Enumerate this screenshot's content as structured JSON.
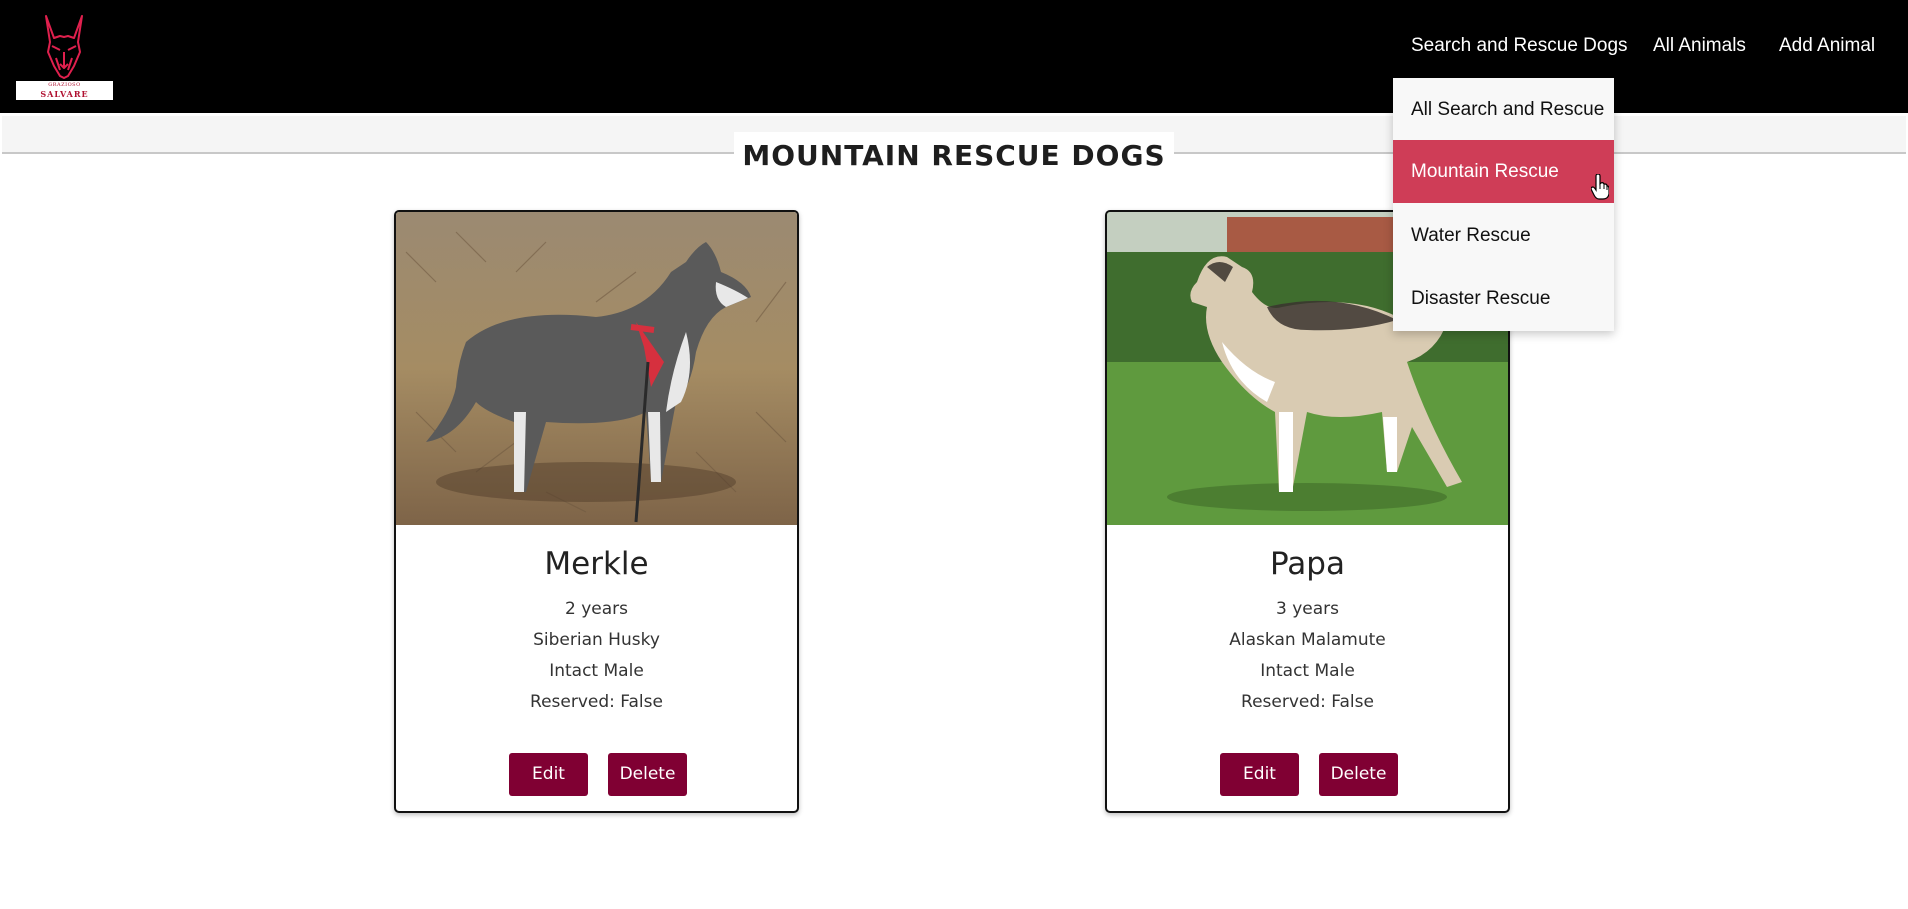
{
  "brand": {
    "logo_small_text": "GRAZIOSO",
    "logo_big_text": "SALVARE",
    "accent_color": "#800033",
    "highlight_color": "#cf3d57"
  },
  "nav": {
    "search_rescue_label": "Search and Rescue Dogs",
    "all_animals_label": "All Animals",
    "add_animal_label": "Add Animal"
  },
  "dropdown": {
    "items": [
      {
        "label": "All Search and Rescue"
      },
      {
        "label": "Mountain Rescue",
        "highlighted": true
      },
      {
        "label": "Water Rescue"
      },
      {
        "label": "Disaster Rescue"
      }
    ]
  },
  "page": {
    "title": "MOUNTAIN RESCUE DOGS"
  },
  "cards": [
    {
      "name": "Merkle",
      "age": "2 years",
      "breed": "Siberian Husky",
      "sex": "Intact Male",
      "reserved": "Reserved: False",
      "edit_label": "Edit",
      "delete_label": "Delete"
    },
    {
      "name": "Papa",
      "age": "3 years",
      "breed": "Alaskan Malamute",
      "sex": "Intact Male",
      "reserved": "Reserved: False",
      "edit_label": "Edit",
      "delete_label": "Delete"
    }
  ],
  "icons": {
    "logo": "german-shepherd-head-icon",
    "cursor": "hand-pointer-icon"
  }
}
